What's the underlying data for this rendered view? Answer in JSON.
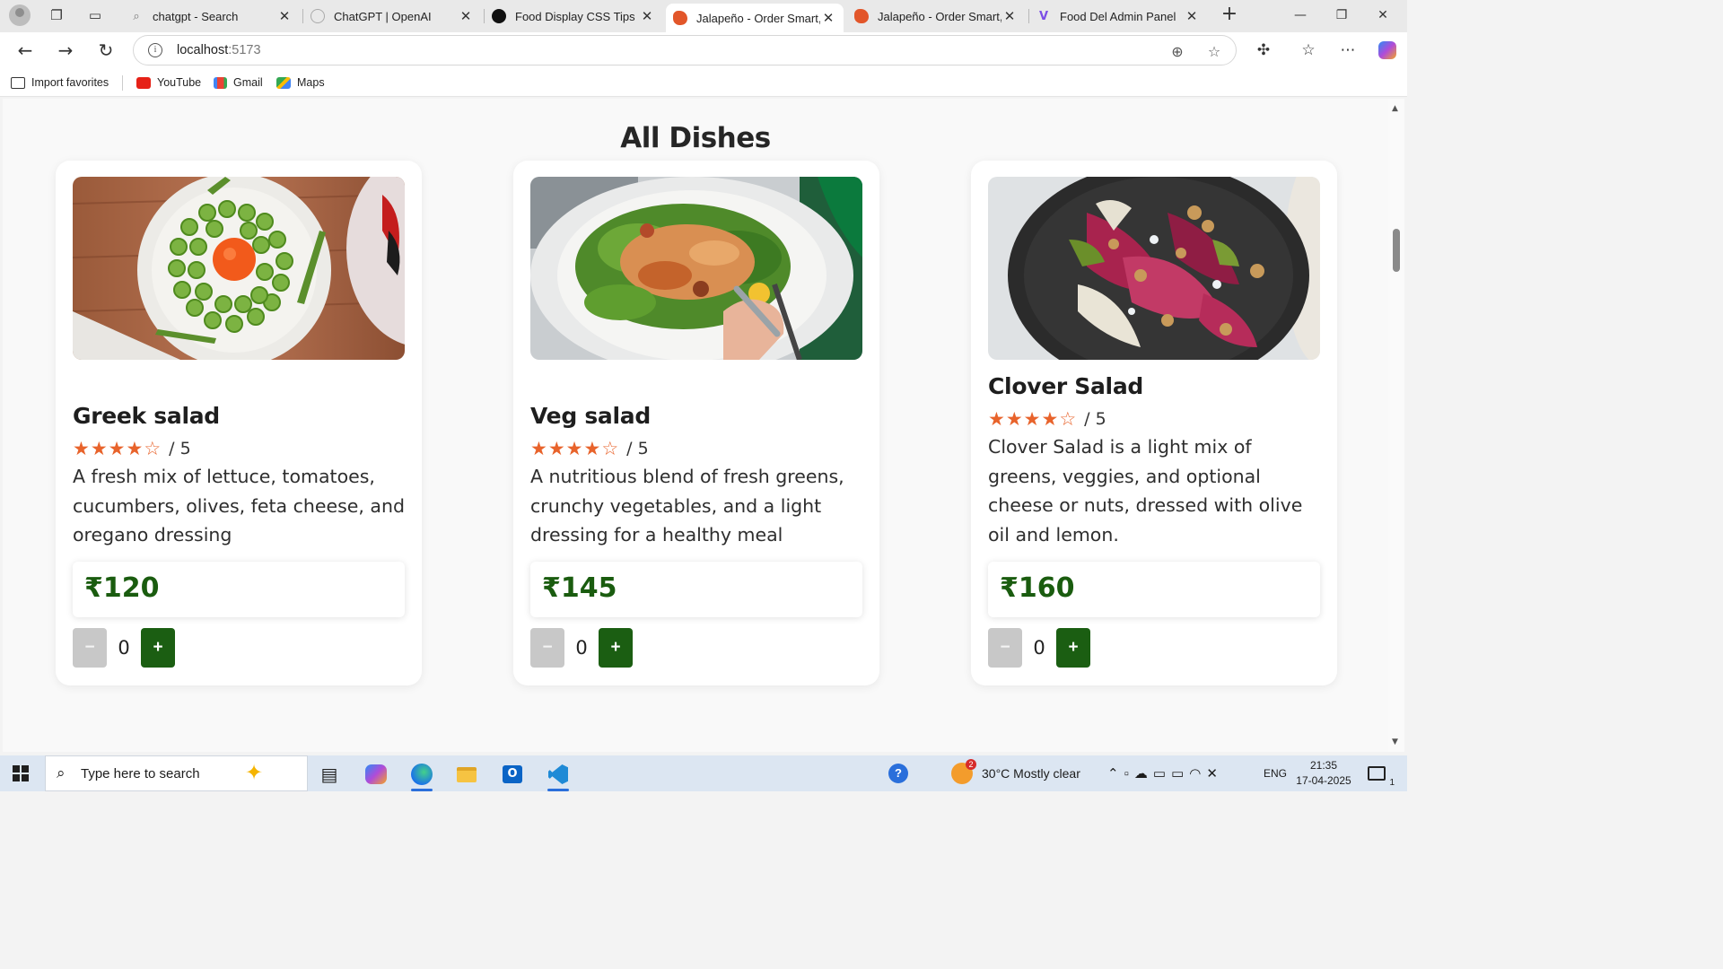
{
  "browser": {
    "tabs": [
      {
        "title": "chatgpt - Search",
        "icon": "search-icon",
        "active": false
      },
      {
        "title": "ChatGPT | OpenAI",
        "icon": "openai-icon",
        "active": false
      },
      {
        "title": "Food Display CSS Tips",
        "icon": "openai-icon",
        "active": false
      },
      {
        "title": "Jalapeño - Order Smart, E",
        "icon": "jalapeno-icon",
        "active": true
      },
      {
        "title": "Jalapeño - Order Smart, E",
        "icon": "jalapeno-icon",
        "active": false
      },
      {
        "title": "Food Del Admin Panel",
        "icon": "vite-icon",
        "active": false
      }
    ],
    "address": {
      "host": "localhost",
      "port": ":5173"
    },
    "favorites": [
      {
        "label": "Import favorites",
        "icon": "import-icon"
      },
      {
        "label": "YouTube",
        "icon": "youtube-icon"
      },
      {
        "label": "Gmail",
        "icon": "gmail-icon"
      },
      {
        "label": "Maps",
        "icon": "maps-icon"
      }
    ]
  },
  "page": {
    "section_title": "All Dishes",
    "dishes": [
      {
        "name": "Greek salad",
        "rating": 4,
        "rating_text": "/ 5",
        "description": "A fresh mix of lettuce, tomatoes, cucumbers, olives, feta cheese, and oregano dressing",
        "price": "₹120",
        "quantity": "0",
        "minus_label": "−",
        "plus_label": "+"
      },
      {
        "name": "Veg salad",
        "rating": 4,
        "rating_text": "/ 5",
        "description": "A nutritious blend of fresh greens, crunchy vegetables, and a light dressing for a healthy meal",
        "price": "₹145",
        "quantity": "0",
        "minus_label": "−",
        "plus_label": "+"
      },
      {
        "name": "Clover Salad",
        "rating": 4,
        "rating_text": "/ 5",
        "description": "Clover Salad is a light mix of greens, veggies, and optional cheese or nuts, dressed with olive oil and lemon.",
        "price": "₹160",
        "quantity": "0",
        "minus_label": "−",
        "plus_label": "+"
      }
    ],
    "colors": {
      "accent_green": "#1b5e12",
      "price_green": "#1a5c0f",
      "star_orange": "#e8632b"
    }
  },
  "taskbar": {
    "search_placeholder": "Type here to search",
    "weather": "30°C  Mostly clear",
    "weather_badge": "2",
    "language": "ENG",
    "time": "21:35",
    "date": "17-04-2025",
    "notification_count": "1"
  }
}
